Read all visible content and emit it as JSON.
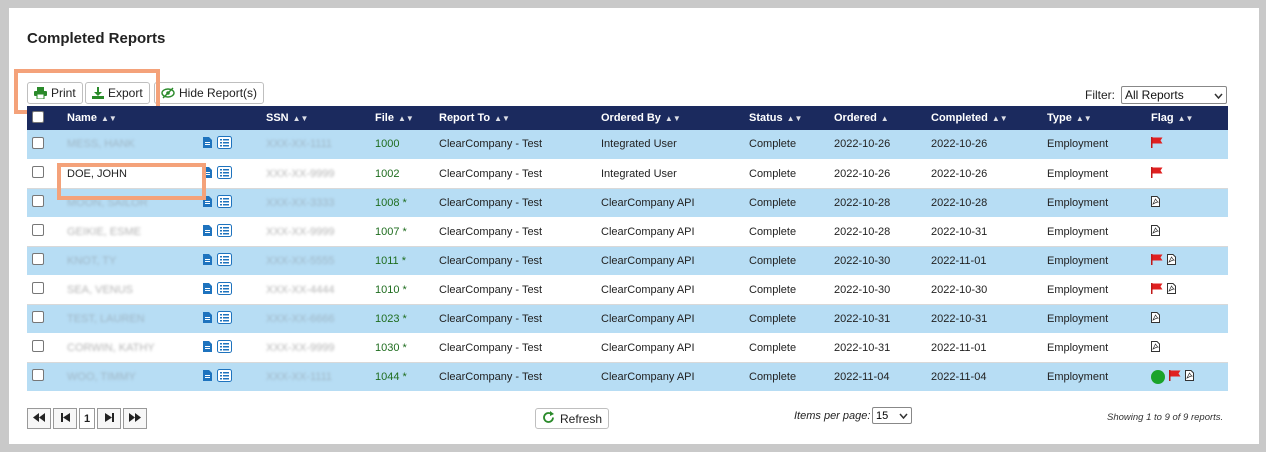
{
  "page": {
    "title": "Completed Reports"
  },
  "toolbar": {
    "print_label": "Print",
    "export_label": "Export",
    "hide_label": "Hide Report(s)"
  },
  "filter": {
    "label": "Filter:",
    "value": "All Reports"
  },
  "columns": {
    "name": "Name",
    "ssn": "SSN",
    "file": "File",
    "report_to": "Report To",
    "ordered_by": "Ordered By",
    "status": "Status",
    "ordered": "Ordered",
    "completed": "Completed",
    "type": "Type",
    "flag": "Flag"
  },
  "rows": [
    {
      "name": "MESS, HANK",
      "ssn": "XXX-XX-1111",
      "file": "1000",
      "report_to": "ClearCompany - Test",
      "ordered_by": "Integrated User",
      "status": "Complete",
      "ordered": "2022-10-26",
      "completed": "2022-10-26",
      "type": "Employment",
      "flags": [
        "red-flag-icon"
      ]
    },
    {
      "name": "DOE, JOHN",
      "ssn": "XXX-XX-9999",
      "file": "1002",
      "report_to": "ClearCompany - Test",
      "ordered_by": "Integrated User",
      "status": "Complete",
      "ordered": "2022-10-26",
      "completed": "2022-10-26",
      "type": "Employment",
      "flags": [
        "red-flag-icon"
      ]
    },
    {
      "name": "MOON, SAILOR",
      "ssn": "XXX-XX-3333",
      "file": "1008 *",
      "report_to": "ClearCompany - Test",
      "ordered_by": "ClearCompany API",
      "status": "Complete",
      "ordered": "2022-10-28",
      "completed": "2022-10-28",
      "type": "Employment",
      "flags": [
        "pdf-icon"
      ]
    },
    {
      "name": "GEIKIE, ESME",
      "ssn": "XXX-XX-9999",
      "file": "1007 *",
      "report_to": "ClearCompany - Test",
      "ordered_by": "ClearCompany API",
      "status": "Complete",
      "ordered": "2022-10-28",
      "completed": "2022-10-31",
      "type": "Employment",
      "flags": [
        "pdf-icon"
      ]
    },
    {
      "name": "KNOT, TY",
      "ssn": "XXX-XX-5555",
      "file": "1011 *",
      "report_to": "ClearCompany - Test",
      "ordered_by": "ClearCompany API",
      "status": "Complete",
      "ordered": "2022-10-30",
      "completed": "2022-11-01",
      "type": "Employment",
      "flags": [
        "red-flag-icon",
        "pdf-icon"
      ]
    },
    {
      "name": "SEA, VENUS",
      "ssn": "XXX-XX-4444",
      "file": "1010 *",
      "report_to": "ClearCompany - Test",
      "ordered_by": "ClearCompany API",
      "status": "Complete",
      "ordered": "2022-10-30",
      "completed": "2022-10-30",
      "type": "Employment",
      "flags": [
        "red-flag-icon",
        "pdf-icon"
      ]
    },
    {
      "name": "TEST, LAUREN",
      "ssn": "XXX-XX-6666",
      "file": "1023 *",
      "report_to": "ClearCompany - Test",
      "ordered_by": "ClearCompany API",
      "status": "Complete",
      "ordered": "2022-10-31",
      "completed": "2022-10-31",
      "type": "Employment",
      "flags": [
        "pdf-icon"
      ]
    },
    {
      "name": "CORWIN, KATHY",
      "ssn": "XXX-XX-9999",
      "file": "1030 *",
      "report_to": "ClearCompany - Test",
      "ordered_by": "ClearCompany API",
      "status": "Complete",
      "ordered": "2022-10-31",
      "completed": "2022-11-01",
      "type": "Employment",
      "flags": [
        "pdf-icon"
      ]
    },
    {
      "name": "WOO, TIMMY",
      "ssn": "XXX-XX-1111",
      "file": "1044 *",
      "report_to": "ClearCompany - Test",
      "ordered_by": "ClearCompany API",
      "status": "Complete",
      "ordered": "2022-11-04",
      "completed": "2022-11-04",
      "type": "Employment",
      "flags": [
        "green-dot-icon",
        "red-flag-icon",
        "pdf-icon"
      ]
    }
  ],
  "pager": {
    "current_page": "1"
  },
  "refresh_label": "Refresh",
  "items_per_page": {
    "label": "Items per page:",
    "value": "15"
  },
  "showing_text": "Showing 1 to 9 of 9 reports.",
  "colors": {
    "header_bg": "#1b2a5e",
    "row_blue": "#b7ddf4",
    "highlight": "#f4a27a",
    "file_green": "#1f6d1f",
    "flag_red": "#e02020",
    "icon_blue": "#1e73be"
  }
}
